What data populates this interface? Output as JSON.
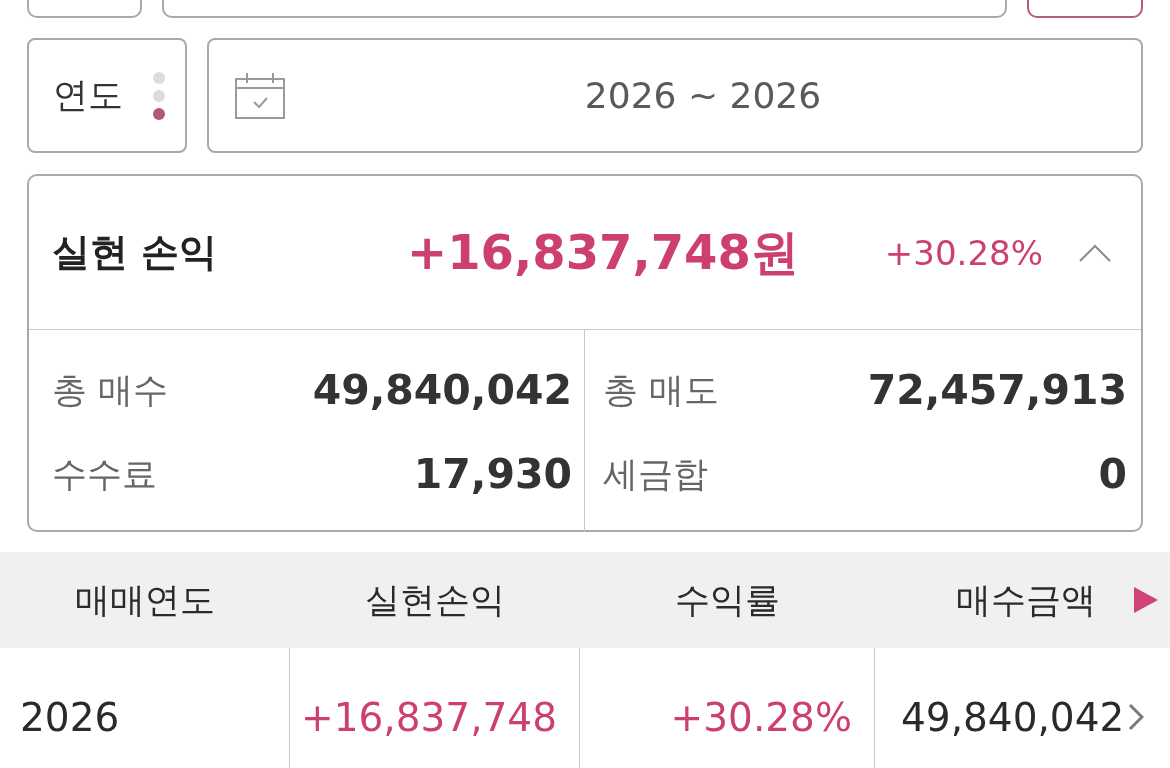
{
  "period_selector": {
    "label": "연도",
    "steps": [
      {
        "selected": false
      },
      {
        "selected": false
      },
      {
        "selected": true
      }
    ]
  },
  "date_range": {
    "value": "2026 ~ 2026"
  },
  "summary": {
    "title": "실현 손익",
    "amount": "+16,837,748원",
    "rate": "+30.28%",
    "gain": true,
    "expanded": true,
    "details": [
      {
        "label": "총 매수",
        "value": "49,840,042"
      },
      {
        "label": "총 매도",
        "value": "72,457,913"
      },
      {
        "label": "수수료",
        "value": "17,930"
      },
      {
        "label": "세금합",
        "value": "0"
      }
    ]
  },
  "table": {
    "columns": [
      "매매연도",
      "실현손익",
      "수익률",
      "매수금액"
    ],
    "rows": [
      {
        "cells": [
          {
            "text": "2026",
            "gain": false
          },
          {
            "text": "+16,837,748",
            "gain": true
          },
          {
            "text": "+30.28%",
            "gain": true
          },
          {
            "text": "49,840,042",
            "gain": false
          }
        ]
      }
    ]
  }
}
